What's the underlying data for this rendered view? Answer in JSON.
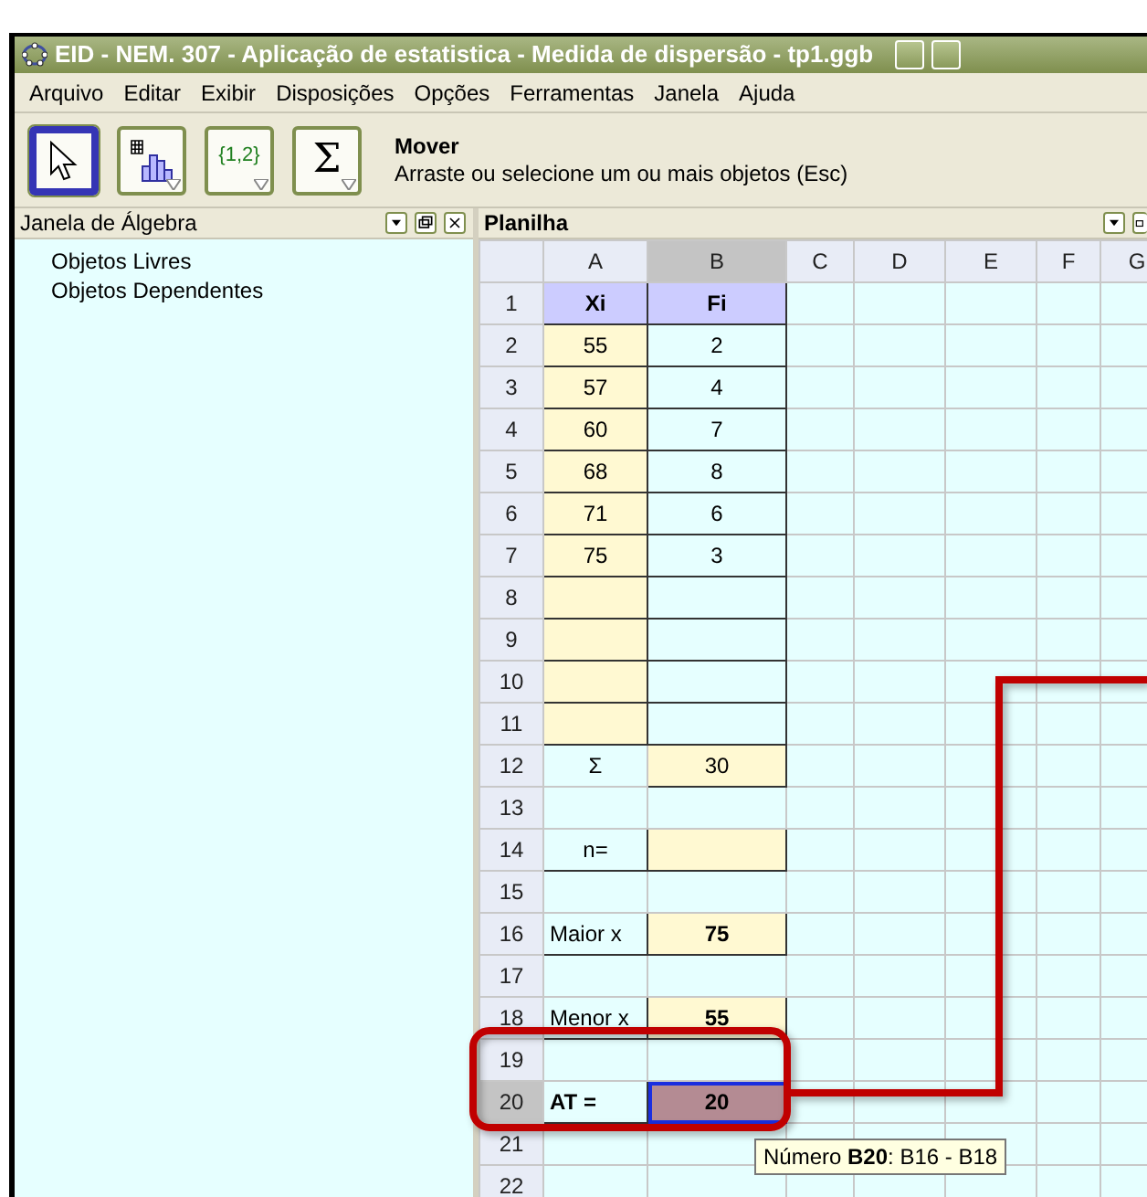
{
  "window": {
    "title": "EID - NEM. 307 - Aplicação de estatistica - Medida de dispersão  - tp1.ggb"
  },
  "menu": [
    "Arquivo",
    "Editar",
    "Exibir",
    "Disposições",
    "Opções",
    "Ferramentas",
    "Janela",
    "Ajuda"
  ],
  "tools": [
    {
      "kind": "move",
      "selected": true
    },
    {
      "kind": "chart",
      "selected": false
    },
    {
      "kind": "list",
      "label": "{1,2}",
      "selected": false
    },
    {
      "kind": "sum",
      "label": "Σ",
      "selected": false
    }
  ],
  "mode": {
    "title": "Mover",
    "hint": "Arraste ou selecione um ou mais objetos (Esc)"
  },
  "algebra": {
    "title": "Janela de Álgebra",
    "items": [
      "Objetos Livres",
      "Objetos Dependentes"
    ]
  },
  "spreadsheet": {
    "title": "Planilha",
    "columns": [
      {
        "label": "A",
        "selected": false
      },
      {
        "label": "B",
        "selected": true
      },
      {
        "label": "C",
        "selected": false
      },
      {
        "label": "D",
        "selected": false
      },
      {
        "label": "E",
        "selected": false
      },
      {
        "label": "F",
        "selected": false
      },
      {
        "label": "G",
        "selected": false
      }
    ],
    "rows": [
      {
        "label": "1",
        "selected": false,
        "cells": [
          {
            "kind": "heading",
            "text": "Xi",
            "bold": true,
            "selected": false
          },
          {
            "kind": "heading",
            "text": "Fi",
            "bold": true,
            "selected": false
          }
        ]
      },
      {
        "label": "2",
        "selected": false,
        "cells": [
          {
            "kind": "input",
            "text": "55",
            "bold": false,
            "selected": false
          },
          {
            "kind": "value",
            "text": "2",
            "bold": false,
            "selected": false
          }
        ]
      },
      {
        "label": "3",
        "selected": false,
        "cells": [
          {
            "kind": "input",
            "text": "57",
            "bold": false,
            "selected": false
          },
          {
            "kind": "value",
            "text": "4",
            "bold": false,
            "selected": false
          }
        ]
      },
      {
        "label": "4",
        "selected": false,
        "cells": [
          {
            "kind": "input",
            "text": "60",
            "bold": false,
            "selected": false
          },
          {
            "kind": "value",
            "text": "7",
            "bold": false,
            "selected": false
          }
        ]
      },
      {
        "label": "5",
        "selected": false,
        "cells": [
          {
            "kind": "input",
            "text": "68",
            "bold": false,
            "selected": false
          },
          {
            "kind": "value",
            "text": "8",
            "bold": false,
            "selected": false
          }
        ]
      },
      {
        "label": "6",
        "selected": false,
        "cells": [
          {
            "kind": "input",
            "text": "71",
            "bold": false,
            "selected": false
          },
          {
            "kind": "value",
            "text": "6",
            "bold": false,
            "selected": false
          }
        ]
      },
      {
        "label": "7",
        "selected": false,
        "cells": [
          {
            "kind": "input",
            "text": "75",
            "bold": false,
            "selected": false
          },
          {
            "kind": "value",
            "text": "3",
            "bold": false,
            "selected": false
          }
        ]
      },
      {
        "label": "8",
        "selected": false,
        "cells": [
          {
            "kind": "input",
            "selected": false
          },
          {
            "kind": "value",
            "selected": false
          }
        ]
      },
      {
        "label": "9",
        "selected": false,
        "cells": [
          {
            "kind": "input",
            "selected": false
          },
          {
            "kind": "value",
            "selected": false
          }
        ]
      },
      {
        "label": "10",
        "selected": false,
        "cells": [
          {
            "kind": "input",
            "selected": false
          },
          {
            "kind": "value",
            "selected": false
          }
        ]
      },
      {
        "label": "11",
        "selected": false,
        "cells": [
          {
            "kind": "input",
            "selected": false
          },
          {
            "kind": "value",
            "selected": false
          }
        ]
      },
      {
        "label": "12",
        "selected": false,
        "cells": [
          {
            "kind": "plain",
            "text": "Σ",
            "bold": false,
            "selected": false
          },
          {
            "kind": "input",
            "text": "30",
            "bold": false,
            "selected": false
          }
        ]
      },
      {
        "label": "13",
        "selected": false,
        "cells": [
          {
            "kind": "plain",
            "selected": false
          },
          {
            "kind": "plain",
            "selected": false
          }
        ]
      },
      {
        "label": "14",
        "selected": false,
        "cells": [
          {
            "kind": "value",
            "text": "n=",
            "bold": false,
            "selected": false
          },
          {
            "kind": "input",
            "selected": false
          }
        ]
      },
      {
        "label": "15",
        "selected": false,
        "cells": [
          {
            "kind": "plain",
            "selected": false
          },
          {
            "kind": "plain",
            "selected": false
          }
        ]
      },
      {
        "label": "16",
        "selected": false,
        "cells": [
          {
            "kind": "label",
            "text": "Maior x",
            "bold": false,
            "selected": false
          },
          {
            "kind": "input",
            "text": "75",
            "bold": true,
            "selected": false
          }
        ]
      },
      {
        "label": "17",
        "selected": false,
        "cells": [
          {
            "kind": "plain",
            "selected": false
          },
          {
            "kind": "plain",
            "selected": false
          }
        ]
      },
      {
        "label": "18",
        "selected": false,
        "cells": [
          {
            "kind": "label",
            "text": "Menor x",
            "bold": false,
            "selected": false
          },
          {
            "kind": "input",
            "text": "55",
            "bold": true,
            "selected": false
          }
        ]
      },
      {
        "label": "19",
        "selected": false,
        "cells": [
          {
            "kind": "plain",
            "selected": false
          },
          {
            "kind": "plain",
            "selected": false
          }
        ]
      },
      {
        "label": "20",
        "selected": true,
        "cells": [
          {
            "kind": "label",
            "text": "AT =",
            "bold": true,
            "selected": false
          },
          {
            "kind": "result",
            "text": "20",
            "bold": true,
            "selected": true
          }
        ]
      },
      {
        "label": "21",
        "selected": false,
        "cells": [
          {
            "kind": "plain",
            "selected": false
          },
          {
            "kind": "plain",
            "selected": false
          }
        ]
      },
      {
        "label": "22",
        "selected": false,
        "cells": [
          {
            "kind": "plain",
            "selected": false
          },
          {
            "kind": "plain",
            "selected": false
          }
        ]
      }
    ],
    "tooltip": "Número **B20**: B16 - B18"
  }
}
